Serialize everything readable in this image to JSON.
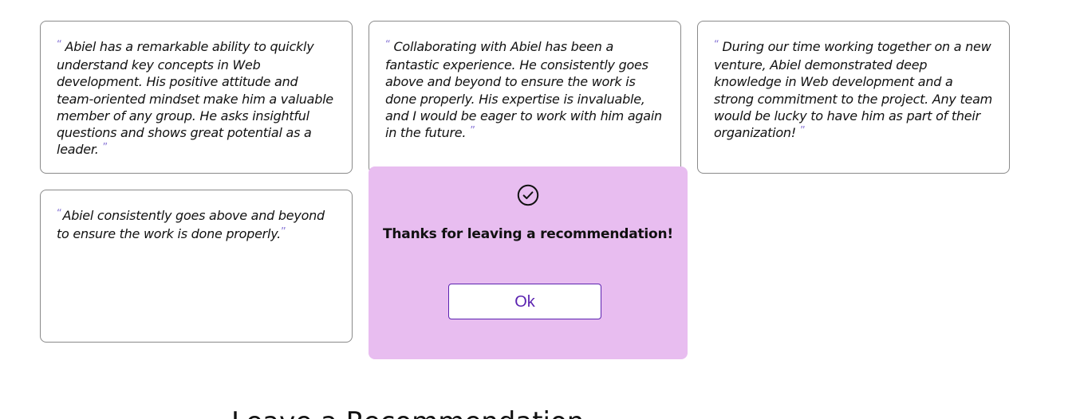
{
  "testimonials": [
    {
      "open_quote": "“",
      "text": "Abiel has a remarkable ability to quickly understand key concepts in Web development. His positive attitude and team-oriented mindset make him a valuable member of any group. He asks insightful questions and shows great potential as a leader.",
      "close_quote": "”"
    },
    {
      "open_quote": "“",
      "text": "Collaborating with Abiel has been a fantastic experience. He consistently goes above and beyond to ensure the work is done properly. His expertise is invaluable, and I would be eager to work with him again in the future.",
      "close_quote": "”"
    },
    {
      "open_quote": "“",
      "text": "During our time working together on a new venture, Abiel demonstrated deep knowledge in Web development and a strong commitment to the project. Any team would be lucky to have him as part of their organization!",
      "close_quote": "”"
    },
    {
      "open_quote": "“",
      "text": "Abiel consistently goes above and beyond to ensure the work is done properly.",
      "close_quote": "”"
    }
  ],
  "modal": {
    "icon": "check-circle-icon",
    "message": "Thanks for leaving a recommendation!",
    "ok_label": "Ok",
    "background_color": "#e8bdf0",
    "accent_color": "#5b23b0"
  },
  "section": {
    "heading": "Leave a Recommendation"
  }
}
